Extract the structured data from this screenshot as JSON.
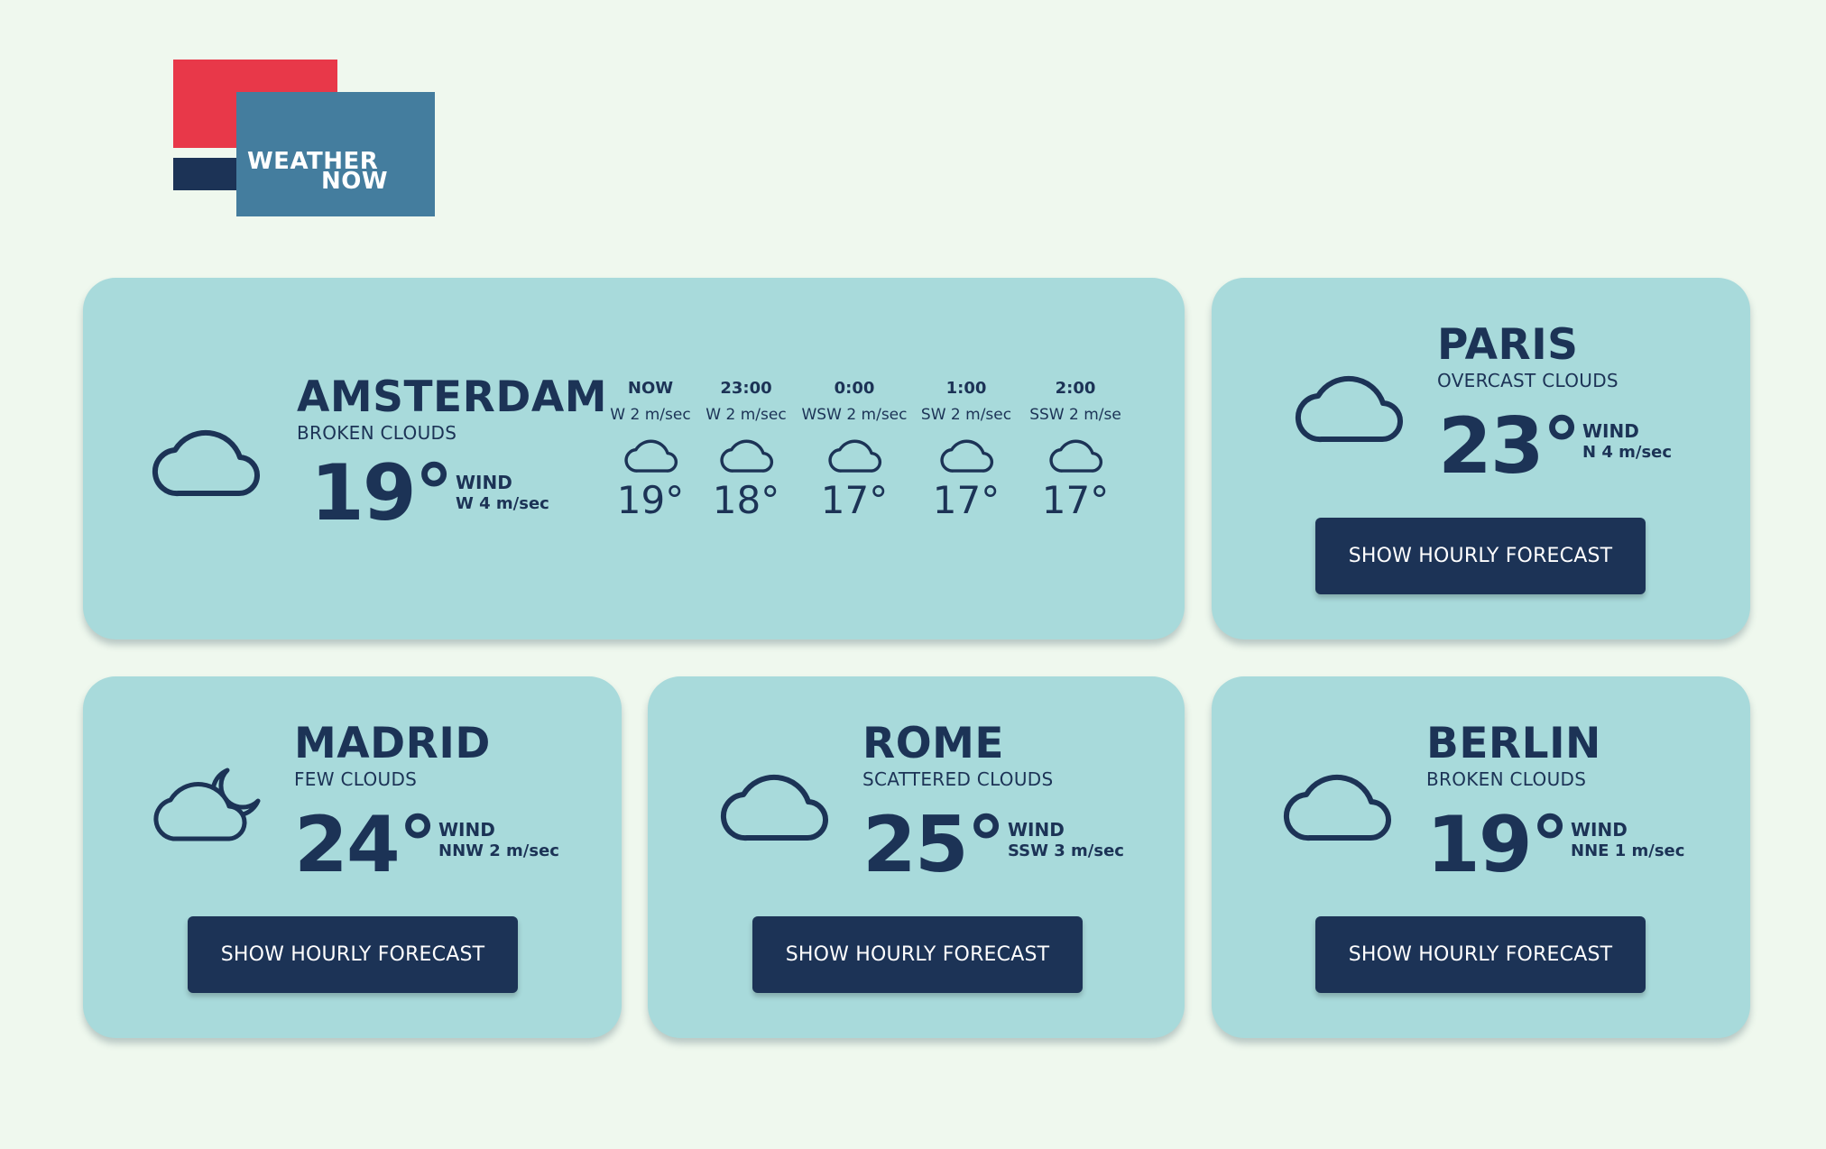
{
  "brand": {
    "line1": "WEATHER",
    "line2": "NOW",
    "colors": {
      "red": "#e83849",
      "blue": "#447d9e",
      "navy": "#1c3356"
    }
  },
  "theme": {
    "background": "#eff8ee",
    "card": "#a8dadb",
    "text": "#1c3356"
  },
  "amsterdam": {
    "city": "AMSTERDAM",
    "condition": "BROKEN CLOUDS",
    "temp": "19°",
    "wind_label": "WIND",
    "wind_value": "W 4 m/sec",
    "icon": "cloud-icon",
    "hourly": [
      {
        "time": "NOW",
        "wind": "W 2 m/sec",
        "temp": "19°",
        "icon": "cloud-icon"
      },
      {
        "time": "23:00",
        "wind": "W 2 m/sec",
        "temp": "18°",
        "icon": "cloud-icon"
      },
      {
        "time": "0:00",
        "wind": "WSW 2 m/sec",
        "temp": "17°",
        "icon": "cloud-icon"
      },
      {
        "time": "1:00",
        "wind": "SW 2 m/sec",
        "temp": "17°",
        "icon": "cloud-icon"
      },
      {
        "time": "2:00",
        "wind": "SSW 2 m/se",
        "temp": "17°",
        "icon": "cloud-icon"
      }
    ]
  },
  "paris": {
    "city": "PARIS",
    "condition": "OVERCAST CLOUDS",
    "temp": "23°",
    "wind_label": "WIND",
    "wind_value": "N 4 m/sec",
    "button": "SHOW HOURLY FORECAST",
    "icon": "cloud-icon"
  },
  "madrid": {
    "city": "MADRID",
    "condition": "FEW CLOUDS",
    "temp": "24°",
    "wind_label": "WIND",
    "wind_value": "NNW 2 m/sec",
    "button": "SHOW HOURLY FORECAST",
    "icon": "cloud-moon-icon"
  },
  "rome": {
    "city": "ROME",
    "condition": "SCATTERED CLOUDS",
    "temp": "25°",
    "wind_label": "WIND",
    "wind_value": "SSW 3 m/sec",
    "button": "SHOW HOURLY FORECAST",
    "icon": "cloud-icon"
  },
  "berlin": {
    "city": "BERLIN",
    "condition": "BROKEN CLOUDS",
    "temp": "19°",
    "wind_label": "WIND",
    "wind_value": "NNE 1 m/sec",
    "button": "SHOW HOURLY FORECAST",
    "icon": "cloud-icon"
  }
}
